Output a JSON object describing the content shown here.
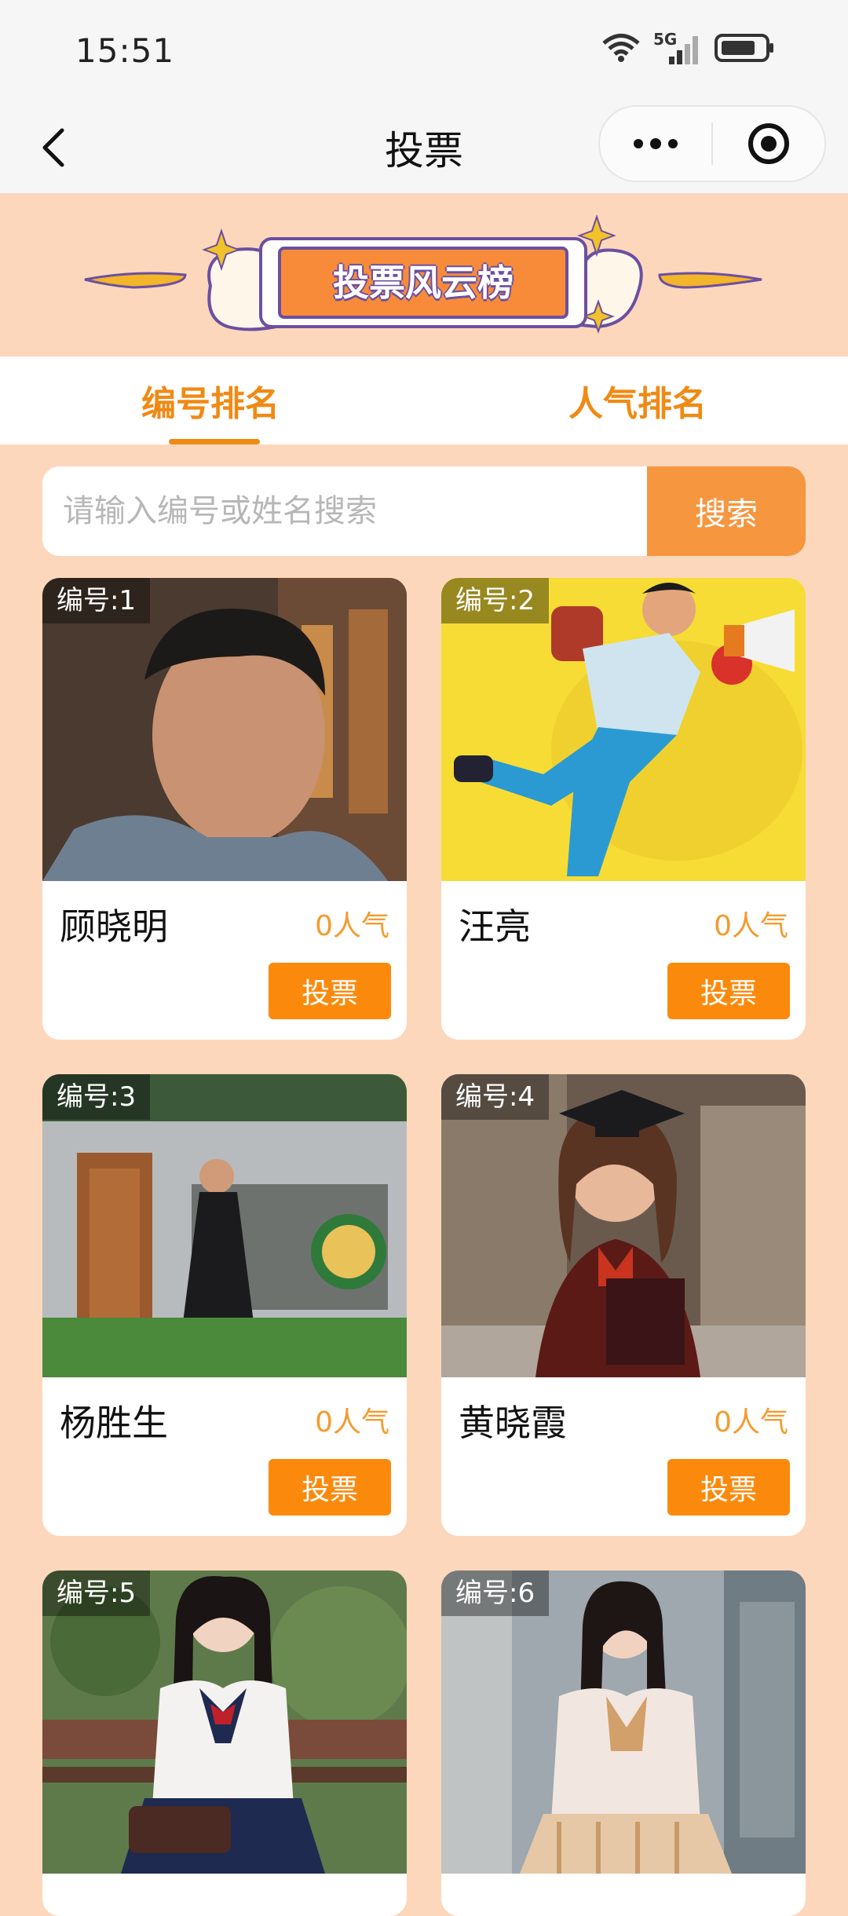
{
  "status": {
    "time": "15:51",
    "network": "5G"
  },
  "nav": {
    "title": "投票"
  },
  "banner": {
    "text": "投票风云榜"
  },
  "tabs": [
    {
      "label": "编号排名"
    },
    {
      "label": "人气排名"
    }
  ],
  "search": {
    "placeholder": "请输入编号或姓名搜索",
    "button": "搜索"
  },
  "contestants": [
    {
      "number": "编号:1",
      "name": "顾晓明",
      "popularity": "0人气",
      "vote": "投票"
    },
    {
      "number": "编号:2",
      "name": "汪亮",
      "popularity": "0人气",
      "vote": "投票"
    },
    {
      "number": "编号:3",
      "name": "杨胜生",
      "popularity": "0人气",
      "vote": "投票"
    },
    {
      "number": "编号:4",
      "name": "黄晓霞",
      "popularity": "0人气",
      "vote": "投票"
    },
    {
      "number": "编号:5",
      "name": "",
      "popularity": "",
      "vote": ""
    },
    {
      "number": "编号:6",
      "name": "",
      "popularity": "",
      "vote": ""
    }
  ],
  "colors": {
    "accent": "#fb8a0c",
    "page_bg": "#fdd7bb",
    "tab_text": "#f08a14"
  }
}
